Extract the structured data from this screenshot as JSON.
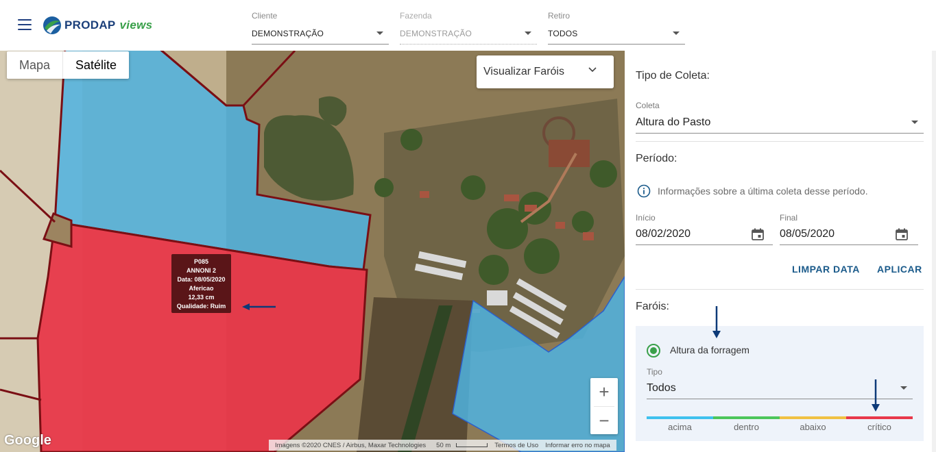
{
  "header": {
    "brand": "PRODAP",
    "brand_suffix": "views",
    "filters": [
      {
        "label": "Cliente",
        "value": "DEMONSTRAÇÃO",
        "disabled": false
      },
      {
        "label": "Fazenda",
        "value": "DEMONSTRAÇÃO",
        "disabled": true
      },
      {
        "label": "Retiro",
        "value": "TODOS",
        "disabled": false
      }
    ]
  },
  "map": {
    "type_buttons": [
      "Mapa",
      "Satélite"
    ],
    "active_type": "Satélite",
    "farois_dropdown": "Visualizar Faróis",
    "tooltip": {
      "line1": "P085",
      "line2": "ANNONI 2",
      "line3": "Data: 08/05/2020",
      "line4": "Afericao",
      "line5": "12,33 cm",
      "line6": "Qualidade: Ruim"
    },
    "zoom_in": "+",
    "zoom_out": "−",
    "google": "Google",
    "attribution": "Imagens ©2020 CNES / Airbus, Maxar Technologies",
    "scale": "50 m",
    "terms": "Termos de Uso",
    "report": "Informar erro no mapa",
    "colors": {
      "blue_area": "#4fb3e0",
      "red_area": "#e8384a",
      "border": "#7a0f14"
    }
  },
  "panel": {
    "tipo_coleta_title": "Tipo de Coleta:",
    "coleta_label": "Coleta",
    "coleta_value": "Altura do Pasto",
    "periodo_title": "Período:",
    "info_text": "Informações sobre a última coleta desse período.",
    "inicio_label": "Início",
    "inicio_value": "08/02/2020",
    "final_label": "Final",
    "final_value": "08/05/2020",
    "limpar_btn": "LIMPAR DATA",
    "aplicar_btn": "APLICAR",
    "farois_title": "Faróis:",
    "radio_label": "Altura da forragem",
    "tipo_label": "Tipo",
    "tipo_value": "Todos",
    "legend": [
      {
        "label": "acima",
        "color": "#3fc1ee"
      },
      {
        "label": "dentro",
        "color": "#4cc65a"
      },
      {
        "label": "abaixo",
        "color": "#f0c142"
      },
      {
        "label": "crítico",
        "color": "#e8384a"
      }
    ]
  }
}
